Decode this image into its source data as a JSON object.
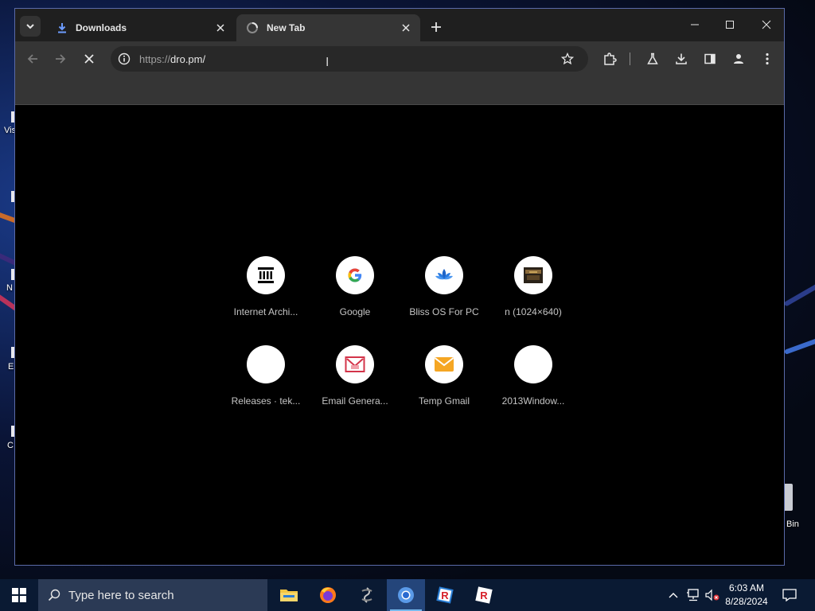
{
  "browser": {
    "tabs": [
      {
        "title": "Downloads",
        "icon": "download-icon",
        "active": false
      },
      {
        "title": "New Tab",
        "icon": "loading-icon",
        "active": true
      }
    ],
    "address": {
      "scheme": "https://",
      "host": "dro.pm/"
    }
  },
  "shortcuts": [
    {
      "label": "Internet Archi...",
      "icon": "internet-archive-icon"
    },
    {
      "label": "Google",
      "icon": "google-icon"
    },
    {
      "label": "Bliss OS For PC",
      "icon": "bliss-os-icon"
    },
    {
      "label": "n (1024×640)",
      "icon": "image-thumbnail-icon"
    },
    {
      "label": "Releases · tek...",
      "icon": "blank-icon"
    },
    {
      "label": "Email Genera...",
      "icon": "email-generator-icon"
    },
    {
      "label": "Temp Gmail",
      "icon": "envelope-icon"
    },
    {
      "label": "2013Window...",
      "icon": "blank-icon"
    }
  ],
  "desktop": {
    "labels": [
      "Vis",
      "N",
      "E",
      "C",
      "Bin"
    ]
  },
  "taskbar": {
    "search_placeholder": "Type here to search",
    "apps": [
      "file-explorer-icon",
      "firefox-icon",
      "app-icon",
      "chromium-icon",
      "roblox-studio-icon",
      "roblox-icon"
    ],
    "time": "6:03 AM",
    "date": "8/28/2024"
  },
  "colors": {
    "accent": "#76b9ed",
    "tab_active": "#353535",
    "toolbar": "#353535",
    "ntp_bg": "#000000"
  }
}
